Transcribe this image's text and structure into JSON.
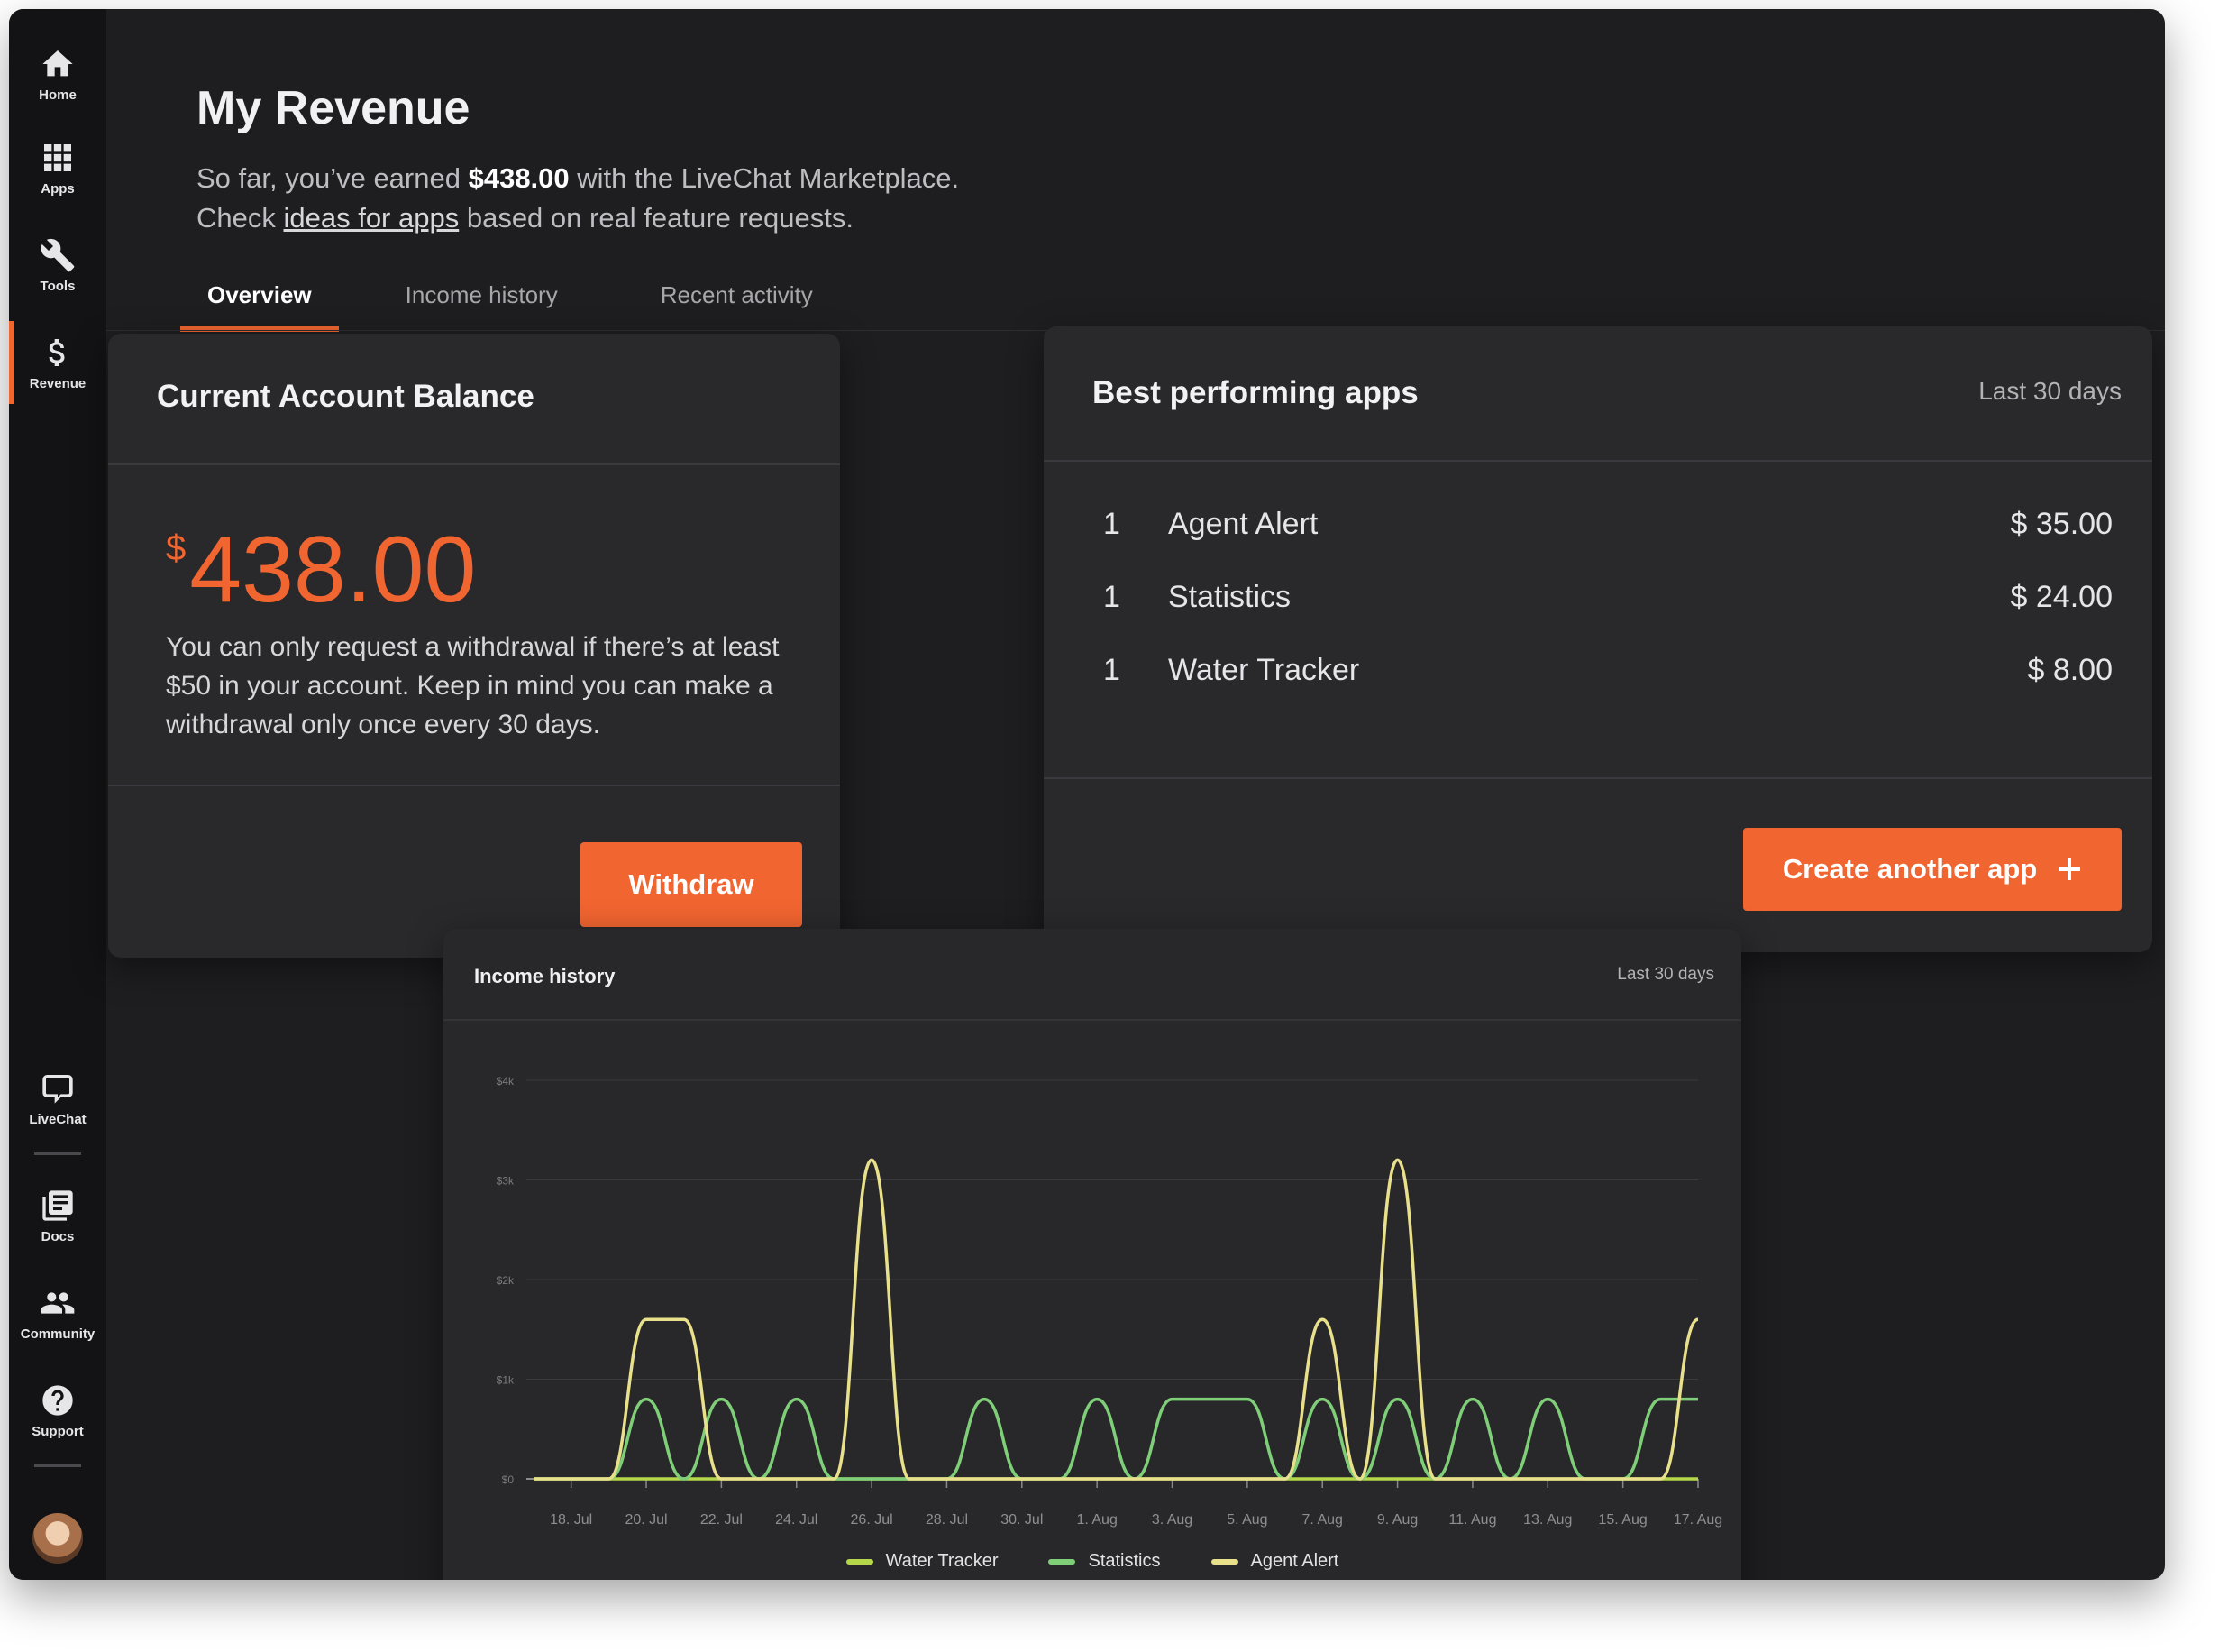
{
  "sidebar": {
    "items": [
      {
        "label": "Home",
        "icon": "home-icon"
      },
      {
        "label": "Apps",
        "icon": "grid-icon"
      },
      {
        "label": "Tools",
        "icon": "wrench-icon"
      },
      {
        "label": "Revenue",
        "icon": "dollar-icon",
        "active": true
      },
      {
        "label": "LiveChat",
        "icon": "chat-bubble-icon"
      },
      {
        "label": "Docs",
        "icon": "docs-icon"
      },
      {
        "label": "Community",
        "icon": "people-icon"
      },
      {
        "label": "Support",
        "icon": "help-icon"
      }
    ]
  },
  "header": {
    "title": "My Revenue",
    "line1_prefix": "So far, you’ve earned ",
    "line1_amount": "$438.00",
    "line1_suffix": " with the LiveChat Marketplace.",
    "line2_prefix": "Check ",
    "line2_link": "ideas for apps",
    "line2_suffix": " based on real feature requests."
  },
  "tabs": [
    {
      "label": "Overview",
      "active": true
    },
    {
      "label": "Income history"
    },
    {
      "label": "Recent activity"
    }
  ],
  "balance": {
    "title": "Current Account Balance",
    "currency": "$",
    "amount": "438.00",
    "note": "You can only request a withdrawal if there’s at least $50 in your account. Keep in mind you can make a withdrawal only once every 30 days.",
    "button": "Withdraw"
  },
  "best_apps": {
    "title": "Best performing apps",
    "range": "Last 30 days",
    "rows": [
      {
        "rank": "1",
        "name": "Agent Alert",
        "value": "$ 35.00"
      },
      {
        "rank": "1",
        "name": "Statistics",
        "value": "$ 24.00"
      },
      {
        "rank": "1",
        "name": "Water Tracker",
        "value": "$ 8.00"
      }
    ],
    "button": "Create another app",
    "button_icon": "plus-icon"
  },
  "income_chart": {
    "title": "Income history",
    "range": "Last 30 days"
  },
  "colors": {
    "accent": "#f16530",
    "water_tracker": "#b5d84a",
    "statistics": "#7fce78",
    "agent_alert": "#e8e08a"
  },
  "chart_data": {
    "type": "line",
    "title": "Income history",
    "x": [
      "17. Jul",
      "18. Jul",
      "19. Jul",
      "20. Jul",
      "21. Jul",
      "22. Jul",
      "23. Jul",
      "24. Jul",
      "25. Jul",
      "26. Jul",
      "27. Jul",
      "28. Jul",
      "29. Jul",
      "30. Jul",
      "31. Jul",
      "1. Aug",
      "2. Aug",
      "3. Aug",
      "4. Aug",
      "5. Aug",
      "6. Aug",
      "7. Aug",
      "8. Aug",
      "9. Aug",
      "10. Aug",
      "11. Aug",
      "12. Aug",
      "13. Aug",
      "14. Aug",
      "15. Aug",
      "16. Aug",
      "17. Aug"
    ],
    "x_tick_labels": [
      "18. Jul",
      "20. Jul",
      "22. Jul",
      "24. Jul",
      "26. Jul",
      "28. Jul",
      "30. Jul",
      "1. Aug",
      "3. Aug",
      "5. Aug",
      "7. Aug",
      "9. Aug",
      "11. Aug",
      "13. Aug",
      "15. Aug",
      "17. Aug"
    ],
    "y_ticks": [
      "$0",
      "$1k",
      "$2k",
      "$3k",
      "$4k"
    ],
    "ylim": [
      0,
      4000
    ],
    "grid": true,
    "legend": "bottom",
    "series": [
      {
        "name": "Water Tracker",
        "values": [
          0,
          0,
          0,
          0,
          0,
          0,
          0,
          0,
          0,
          0,
          0,
          0,
          0,
          0,
          0,
          0,
          0,
          0,
          0,
          0,
          0,
          0,
          0,
          0,
          0,
          0,
          0,
          0,
          0,
          0,
          0,
          0
        ]
      },
      {
        "name": "Statistics",
        "values": [
          0,
          0,
          0,
          800,
          0,
          800,
          0,
          800,
          0,
          0,
          0,
          0,
          800,
          0,
          0,
          800,
          0,
          800,
          800,
          800,
          0,
          800,
          0,
          800,
          0,
          800,
          0,
          800,
          0,
          0,
          800,
          800
        ]
      },
      {
        "name": "Agent Alert",
        "values": [
          0,
          0,
          0,
          1600,
          1600,
          0,
          0,
          0,
          0,
          3200,
          0,
          0,
          0,
          0,
          0,
          0,
          0,
          0,
          0,
          0,
          0,
          1600,
          0,
          3200,
          0,
          0,
          0,
          0,
          0,
          0,
          0,
          1600
        ]
      }
    ]
  }
}
